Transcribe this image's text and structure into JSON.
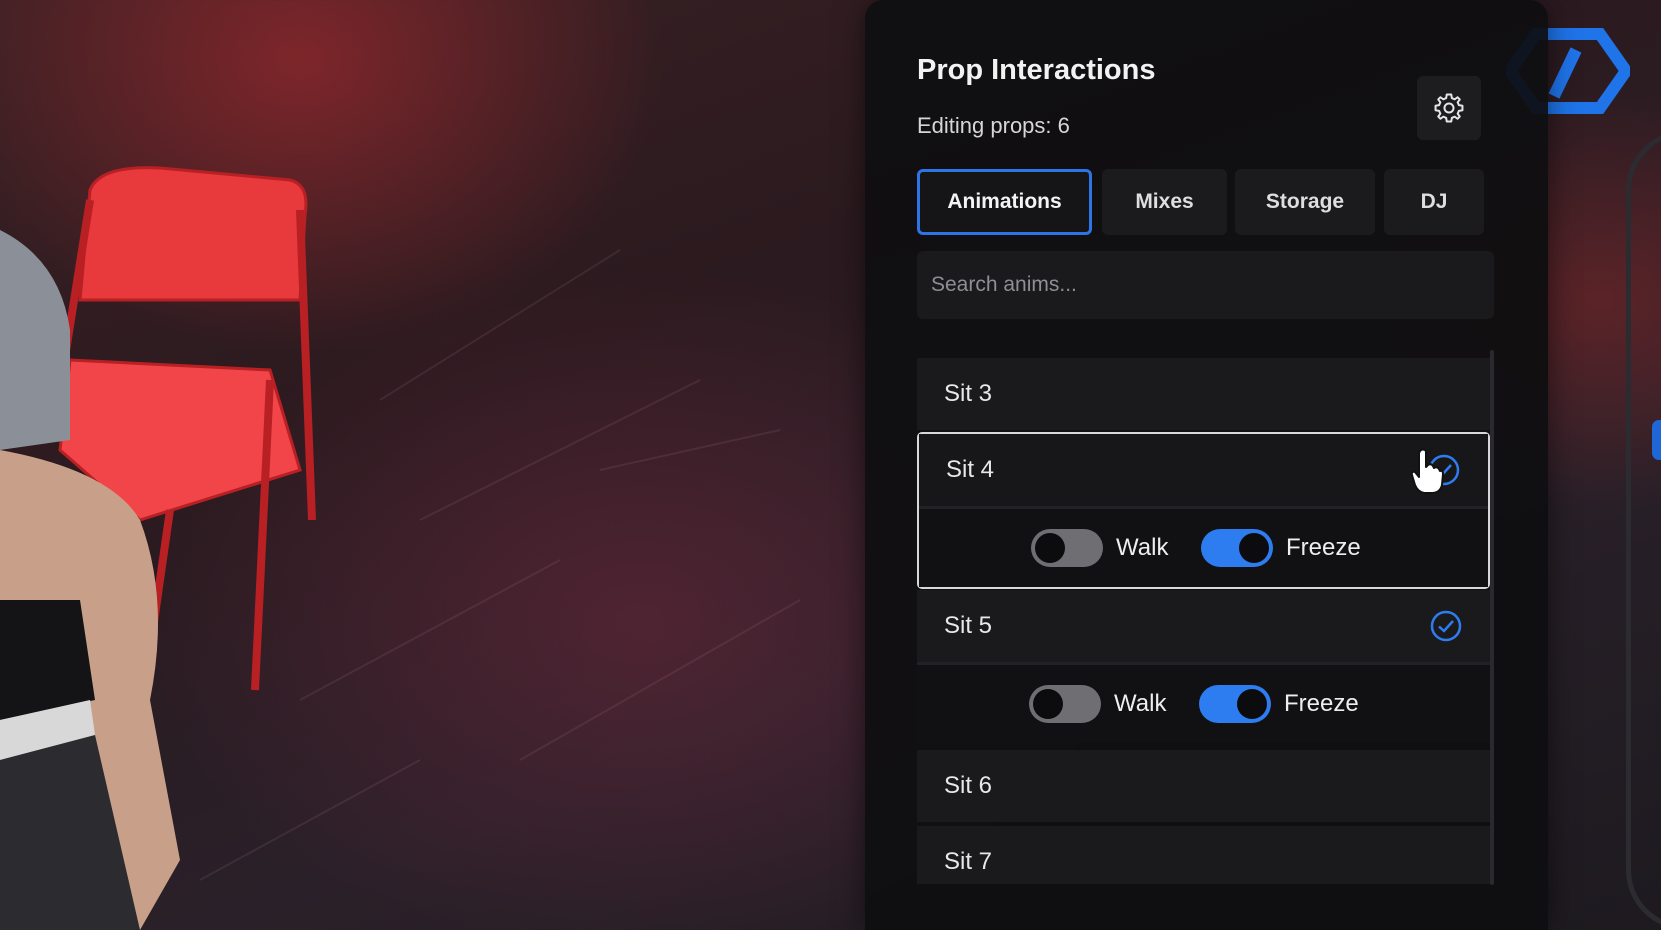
{
  "panel": {
    "title": "Prop Interactions",
    "subtitle": "Editing props: 6",
    "settings_icon": "gear-icon"
  },
  "tabs": [
    {
      "label": "Animations",
      "active": true
    },
    {
      "label": "Mixes",
      "active": false
    },
    {
      "label": "Storage",
      "active": false
    },
    {
      "label": "DJ",
      "active": false
    }
  ],
  "search": {
    "placeholder": "Search anims...",
    "value": ""
  },
  "animations": [
    {
      "label": "Sit 3",
      "expanded": false,
      "checked": false
    },
    {
      "label": "Sit 4",
      "expanded": true,
      "checked": true,
      "walk": {
        "label": "Walk",
        "on": false
      },
      "freeze": {
        "label": "Freeze",
        "on": true
      }
    },
    {
      "label": "Sit 5",
      "expanded": true,
      "checked": true,
      "walk": {
        "label": "Walk",
        "on": false
      },
      "freeze": {
        "label": "Freeze",
        "on": true
      }
    },
    {
      "label": "Sit 6",
      "expanded": false,
      "checked": false
    },
    {
      "label": "Sit 7",
      "expanded": false,
      "checked": false
    }
  ],
  "colors": {
    "accent": "#2d7cf0",
    "panel_bg": "#0e0e10",
    "chair": "#e83a3e"
  },
  "icons": [
    "gear-icon",
    "check-circle-icon",
    "logo-icon",
    "hand-cursor-icon"
  ]
}
